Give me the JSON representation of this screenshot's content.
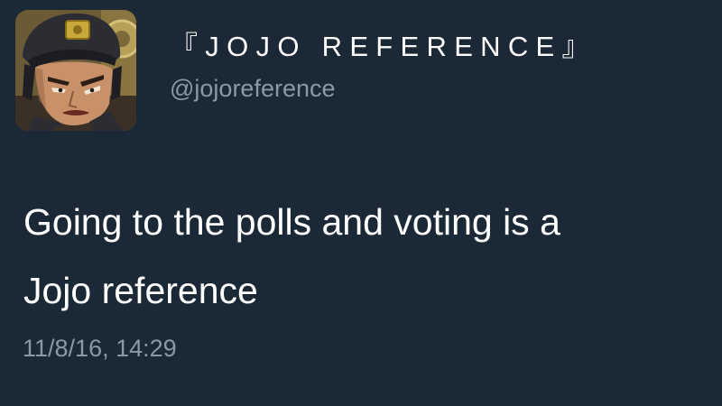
{
  "tweet": {
    "display_name": "『JOJO REFERENCE』",
    "handle": "@jojoreference",
    "text_line1": "Going to the polls and voting is a",
    "text_line2": "Jojo reference",
    "timestamp": "11/8/16, 14:29"
  },
  "colors": {
    "background": "#1b2836",
    "text_primary": "#ffffff",
    "text_secondary": "#8b98a5"
  },
  "icons": {
    "avatar": "jotaro-kujo-avatar"
  }
}
